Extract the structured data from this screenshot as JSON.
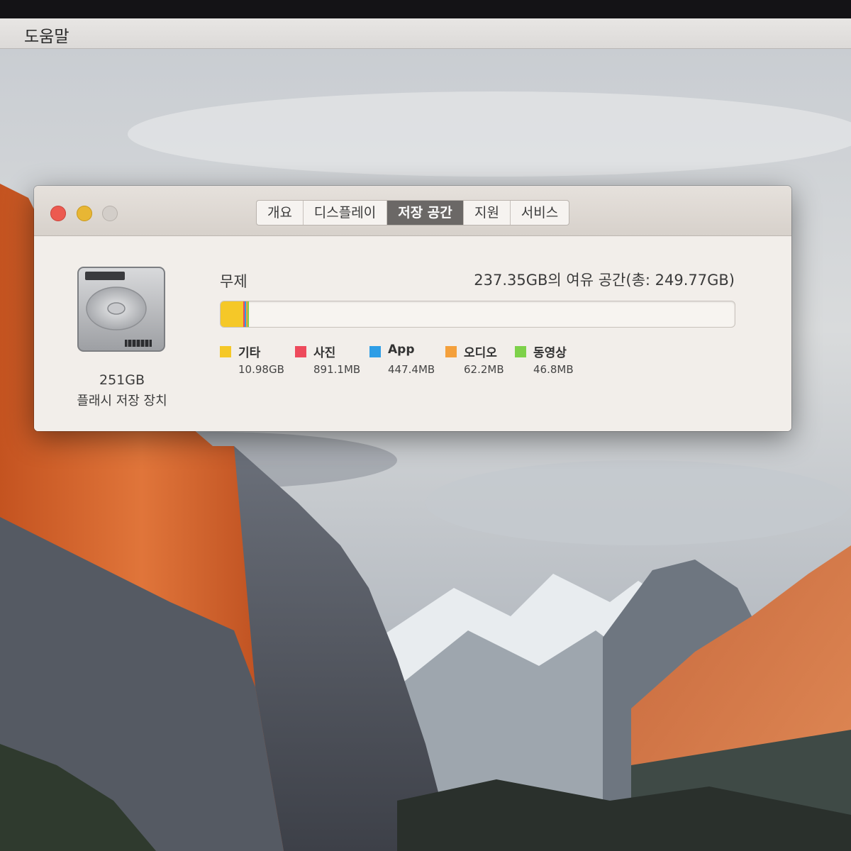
{
  "menubar": {
    "help_label": "도움말"
  },
  "window": {
    "tabs": [
      {
        "label": "개요",
        "selected": false
      },
      {
        "label": "디스플레이",
        "selected": false
      },
      {
        "label": "저장 공간",
        "selected": true
      },
      {
        "label": "지원",
        "selected": false
      },
      {
        "label": "서비스",
        "selected": false
      }
    ],
    "drive": {
      "icon": "hard-drive-icon",
      "size_label": "251GB",
      "kind_label": "플래시 저장 장치"
    },
    "volume": {
      "name": "무제",
      "free_label": "237.35GB의 여유 공간(총: 249.77GB)",
      "total_gb": 249.77,
      "free_gb": 237.35
    },
    "usage": [
      {
        "label": "기타",
        "size": "10.98GB",
        "gb": 10.98,
        "color": "#f5c828"
      },
      {
        "label": "사진",
        "size": "891.1MB",
        "gb": 0.891,
        "color": "#ee4a5c"
      },
      {
        "label": "App",
        "size": "447.4MB",
        "gb": 0.447,
        "color": "#2f9ee6"
      },
      {
        "label": "오디오",
        "size": "62.2MB",
        "gb": 0.062,
        "color": "#f4a03c"
      },
      {
        "label": "동영상",
        "size": "46.8MB",
        "gb": 0.047,
        "color": "#7ed14a"
      }
    ]
  },
  "colors": {
    "close": "#ec5a50",
    "minimize": "#e8b634",
    "zoom": "#d3cec9",
    "selected_tab": "#6b6866"
  }
}
